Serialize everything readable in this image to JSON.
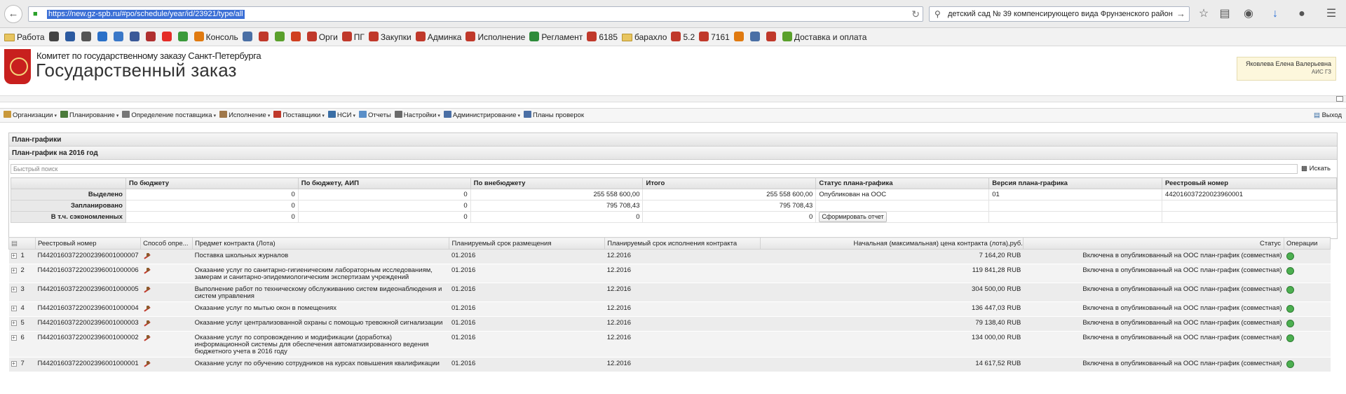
{
  "browser": {
    "url": "https://new.gz-spb.ru/#po/schedule/year/id/23921/type/all",
    "search_query": "детский сад № 39 компенсирующего вида Фрунзенского район"
  },
  "bookmarks": [
    {
      "label": "Работа",
      "icon": "folder-icon"
    },
    {
      "label": "",
      "icon": "site-icon-1"
    },
    {
      "label": "",
      "icon": "site-icon-2"
    },
    {
      "label": "",
      "icon": "site-icon-3"
    },
    {
      "label": "",
      "icon": "site-icon-4"
    },
    {
      "label": "",
      "icon": "site-icon-5"
    },
    {
      "label": "",
      "icon": "facebook-icon"
    },
    {
      "label": "",
      "icon": "site-icon-6"
    },
    {
      "label": "",
      "icon": "youtube-icon"
    },
    {
      "label": "",
      "icon": "site-icon-7"
    },
    {
      "label": "Консоль",
      "icon": "site-icon-8"
    },
    {
      "label": "",
      "icon": "site-icon-9"
    },
    {
      "label": "",
      "icon": "site-icon-10"
    },
    {
      "label": "",
      "icon": "site-icon-11"
    },
    {
      "label": "",
      "icon": "site-icon-12"
    },
    {
      "label": "Орги",
      "icon": "tools-icon"
    },
    {
      "label": "ПГ",
      "icon": "tools-icon"
    },
    {
      "label": "Закупки",
      "icon": "tools-icon"
    },
    {
      "label": "Админка",
      "icon": "tools-icon"
    },
    {
      "label": "Исполнение",
      "icon": "tools-icon"
    },
    {
      "label": "Регламент",
      "icon": "sheet-icon"
    },
    {
      "label": "6185",
      "icon": "redmine-icon"
    },
    {
      "label": "барахло",
      "icon": "folder-icon"
    },
    {
      "label": "5.2",
      "icon": "redmine-icon"
    },
    {
      "label": "7161",
      "icon": "redmine-icon"
    },
    {
      "label": "",
      "icon": "site-icon-13"
    },
    {
      "label": "",
      "icon": "speaker-icon"
    },
    {
      "label": "",
      "icon": "site-icon-14"
    },
    {
      "label": "Доставка и оплата",
      "icon": "site-icon-15"
    }
  ],
  "header": {
    "org": "Комитет по государственному заказу Санкт-Петербурга",
    "title": "Государственный заказ",
    "user_name": "Яковлева Елена Валерьевна",
    "user_sub": "АИС ГЗ"
  },
  "menu": [
    {
      "label": "Организации",
      "dropdown": true,
      "color": "#c9983a"
    },
    {
      "label": "Планирование",
      "dropdown": true,
      "color": "#4a7a3a"
    },
    {
      "label": "Определение поставщика",
      "dropdown": true,
      "color": "#777777"
    },
    {
      "label": "Исполнение",
      "dropdown": true,
      "color": "#a0784a"
    },
    {
      "label": "Поставщики",
      "dropdown": true,
      "color": "#c0392b"
    },
    {
      "label": "НСИ",
      "dropdown": true,
      "color": "#3a6ea5"
    },
    {
      "label": "Отчеты",
      "dropdown": false,
      "color": "#5a8fc8"
    },
    {
      "label": "Настройки",
      "dropdown": true,
      "color": "#6a6a6a"
    },
    {
      "label": "Администрирование",
      "dropdown": true,
      "color": "#4a6fa5"
    },
    {
      "label": "Планы проверок",
      "dropdown": false,
      "color": "#4a6fa5"
    }
  ],
  "exit_label": "Выход",
  "panel": {
    "title": "План-графики",
    "subtitle": "План-график на 2016 год",
    "search_placeholder": "Быстрый поиск",
    "search_button": "Искать"
  },
  "summary": {
    "headers": [
      "",
      "По бюджету",
      "По бюджету, АИП",
      "По внебюджету",
      "Итого",
      "Статус плана-графика",
      "Версия плана-графика",
      "Реестровый номер"
    ],
    "rows": [
      {
        "label": "Выделено",
        "budget": "0",
        "budget_aip": "0",
        "extra": "255 558 600,00",
        "total": "255 558 600,00",
        "status": "Опубликован на ООС",
        "version": "01",
        "reg": "442016037220023960001"
      },
      {
        "label": "Запланировано",
        "budget": "0",
        "budget_aip": "0",
        "extra": "795 708,43",
        "total": "795 708,43",
        "status": "",
        "version": "",
        "reg": ""
      },
      {
        "label": "В т.ч. сэкономленных",
        "budget": "0",
        "budget_aip": "0",
        "extra": "0",
        "total": "0",
        "status": "Сформировать отчет",
        "version": "",
        "reg": ""
      }
    ]
  },
  "positions": {
    "headers": [
      "",
      "Реестровый номер",
      "Способ опре...",
      "Предмет контракта (Лота)",
      "Планируемый срок размещения",
      "Планируемый срок исполнения контракта",
      "Начальная (максимальная) цена контракта (лота),руб.",
      "Статус",
      "Операции"
    ],
    "rows": [
      {
        "n": "1",
        "reg": "П44201603722002396001000007",
        "subject": "Поставка школьных журналов",
        "place": "01.2016",
        "exec": "12.2016",
        "price": "7 164,20 RUB",
        "status": "Включена в опубликованный на ООС план-график (совместная)"
      },
      {
        "n": "2",
        "reg": "П44201603722002396001000006",
        "subject": "Оказание услуг по санитарно-гигиеническим лабораторным исследованиям, замерам и санитарно-эпидемиологическим экспертизам учреждений",
        "place": "01.2016",
        "exec": "12.2016",
        "price": "119 841,28 RUB",
        "status": "Включена в опубликованный на ООС план-график (совместная)"
      },
      {
        "n": "3",
        "reg": "П44201603722002396001000005",
        "subject": "Выполнение работ по техническому обслуживанию систем видеонаблюдения и систем управления",
        "place": "01.2016",
        "exec": "12.2016",
        "price": "304 500,00 RUB",
        "status": "Включена в опубликованный на ООС план-график (совместная)"
      },
      {
        "n": "4",
        "reg": "П44201603722002396001000004",
        "subject": "Оказание услуг по мытью окон в помещениях",
        "place": "01.2016",
        "exec": "12.2016",
        "price": "136 447,03 RUB",
        "status": "Включена в опубликованный на ООС план-график (совместная)"
      },
      {
        "n": "5",
        "reg": "П44201603722002396001000003",
        "subject": "Оказание услуг централизованной охраны с помощью тревожной сигнализации",
        "place": "01.2016",
        "exec": "12.2016",
        "price": "79 138,40 RUB",
        "status": "Включена в опубликованный на ООС план-график (совместная)"
      },
      {
        "n": "6",
        "reg": "П44201603722002396001000002",
        "subject": "Оказание услуг по сопровождению и модификации (доработка) информационной системы для обеспечения автоматизированного ведения бюджетного учета в 2016 году",
        "place": "01.2016",
        "exec": "12.2016",
        "price": "134 000,00 RUB",
        "status": "Включена в опубликованный на ООС план-график (совместная)"
      },
      {
        "n": "7",
        "reg": "П44201603722002396001000001",
        "subject": "Оказание услуг по обучению сотрудников на курсах повышения квалификации",
        "place": "01.2016",
        "exec": "12.2016",
        "price": "14 617,52 RUB",
        "status": "Включена в опубликованный на ООС план-график (совместная)"
      }
    ]
  }
}
